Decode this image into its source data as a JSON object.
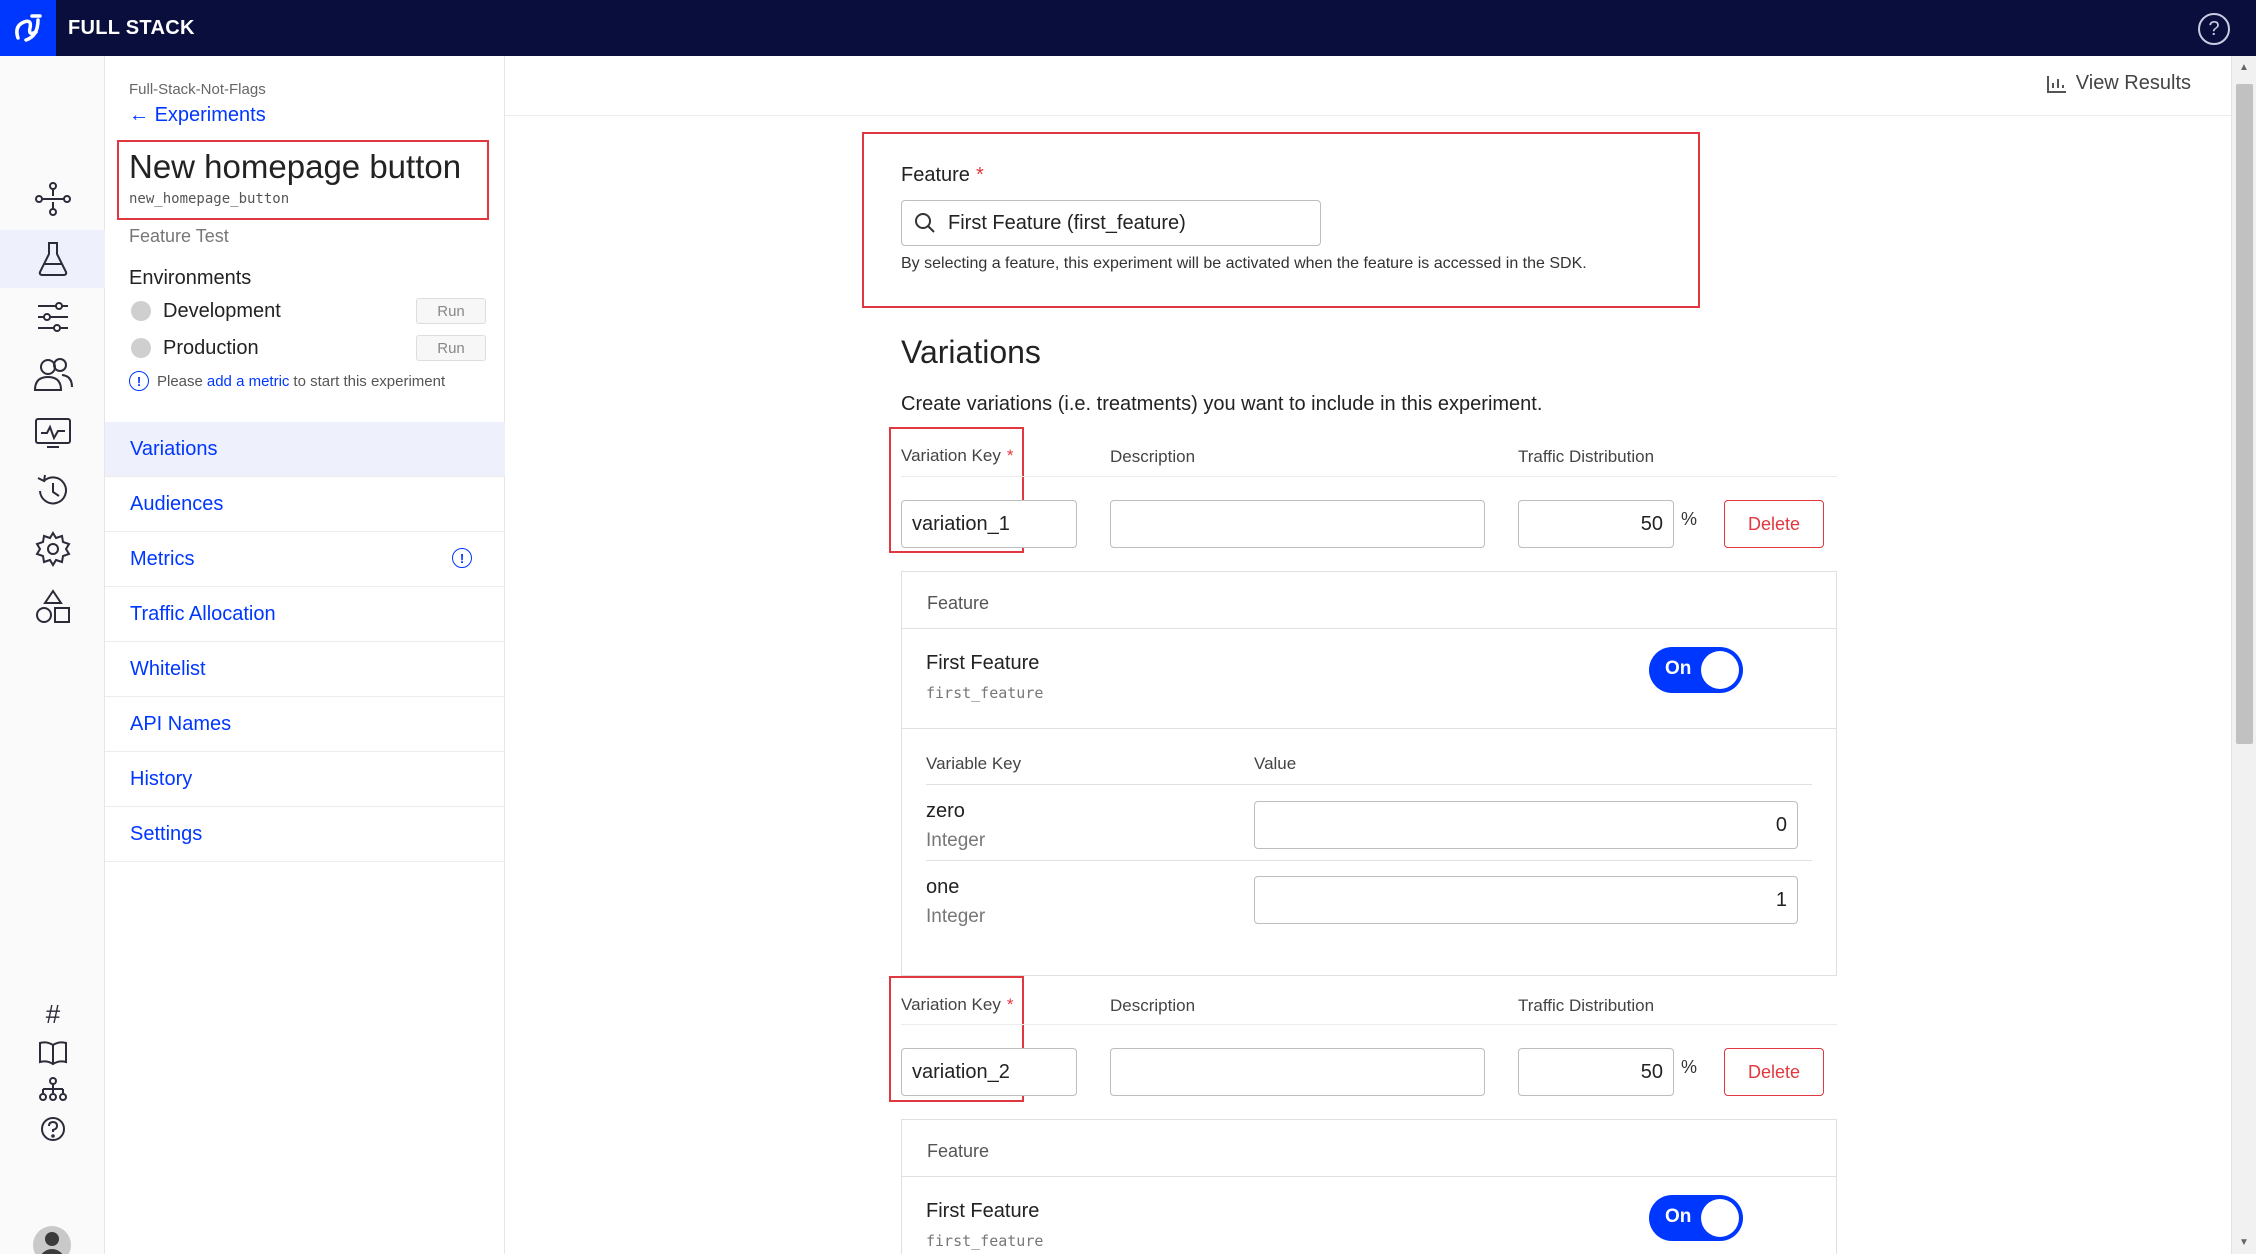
{
  "app": {
    "brand": "FULL STACK",
    "help_glyph": "?"
  },
  "rail": {
    "icons": [
      "branch-icon",
      "flask-icon",
      "sliders-icon",
      "users-icon",
      "monitor-icon",
      "history-icon",
      "gear-icon",
      "shapes-icon",
      "hash-icon",
      "book-icon",
      "org-icon",
      "help-icon"
    ],
    "active": "flask-icon"
  },
  "sidebar": {
    "project": "Full-Stack-Not-Flags",
    "back_label": "Experiments",
    "experiment_title": "New homepage button",
    "experiment_key": "new_homepage_button",
    "experiment_type": "Feature Test",
    "environments_label": "Environments",
    "environments": [
      {
        "name": "Development",
        "button": "Run"
      },
      {
        "name": "Production",
        "button": "Run"
      }
    ],
    "hint_prefix": "Please",
    "hint_link": "add a metric",
    "hint_suffix": "to start this experiment",
    "nav": [
      {
        "label": "Variations"
      },
      {
        "label": "Audiences"
      },
      {
        "label": "Metrics"
      },
      {
        "label": "Traffic Allocation"
      },
      {
        "label": "Whitelist"
      },
      {
        "label": "API Names"
      },
      {
        "label": "History"
      },
      {
        "label": "Settings"
      }
    ]
  },
  "main": {
    "view_results": "View Results",
    "feature": {
      "label": "Feature",
      "required": "*",
      "value": "First Feature (first_feature)",
      "help": "By selecting a feature, this experiment will be activated when the feature is accessed in the SDK."
    },
    "variations_heading": "Variations",
    "variations_intro": "Create variations (i.e. treatments) you want to include in this experiment.",
    "columns": {
      "key": "Variation Key",
      "description": "Description",
      "traffic": "Traffic Distribution",
      "required": "*"
    },
    "percent_sign": "%",
    "delete_label": "Delete",
    "variations": [
      {
        "key": "variation_1",
        "description": "",
        "traffic": "50",
        "feature_header": "Feature",
        "feature_name": "First Feature",
        "feature_key": "first_feature",
        "toggle": "On",
        "var_col_key": "Variable Key",
        "var_col_value": "Value",
        "variables": [
          {
            "key": "zero",
            "type": "Integer",
            "value": "0"
          },
          {
            "key": "one",
            "type": "Integer",
            "value": "1"
          }
        ]
      },
      {
        "key": "variation_2",
        "description": "",
        "traffic": "50",
        "feature_header": "Feature",
        "feature_name": "First Feature",
        "feature_key": "first_feature",
        "toggle": "On"
      }
    ]
  },
  "colors": {
    "topbar": "#0a0e3d",
    "accent": "#0037ff",
    "highlight": "#e0383e"
  }
}
